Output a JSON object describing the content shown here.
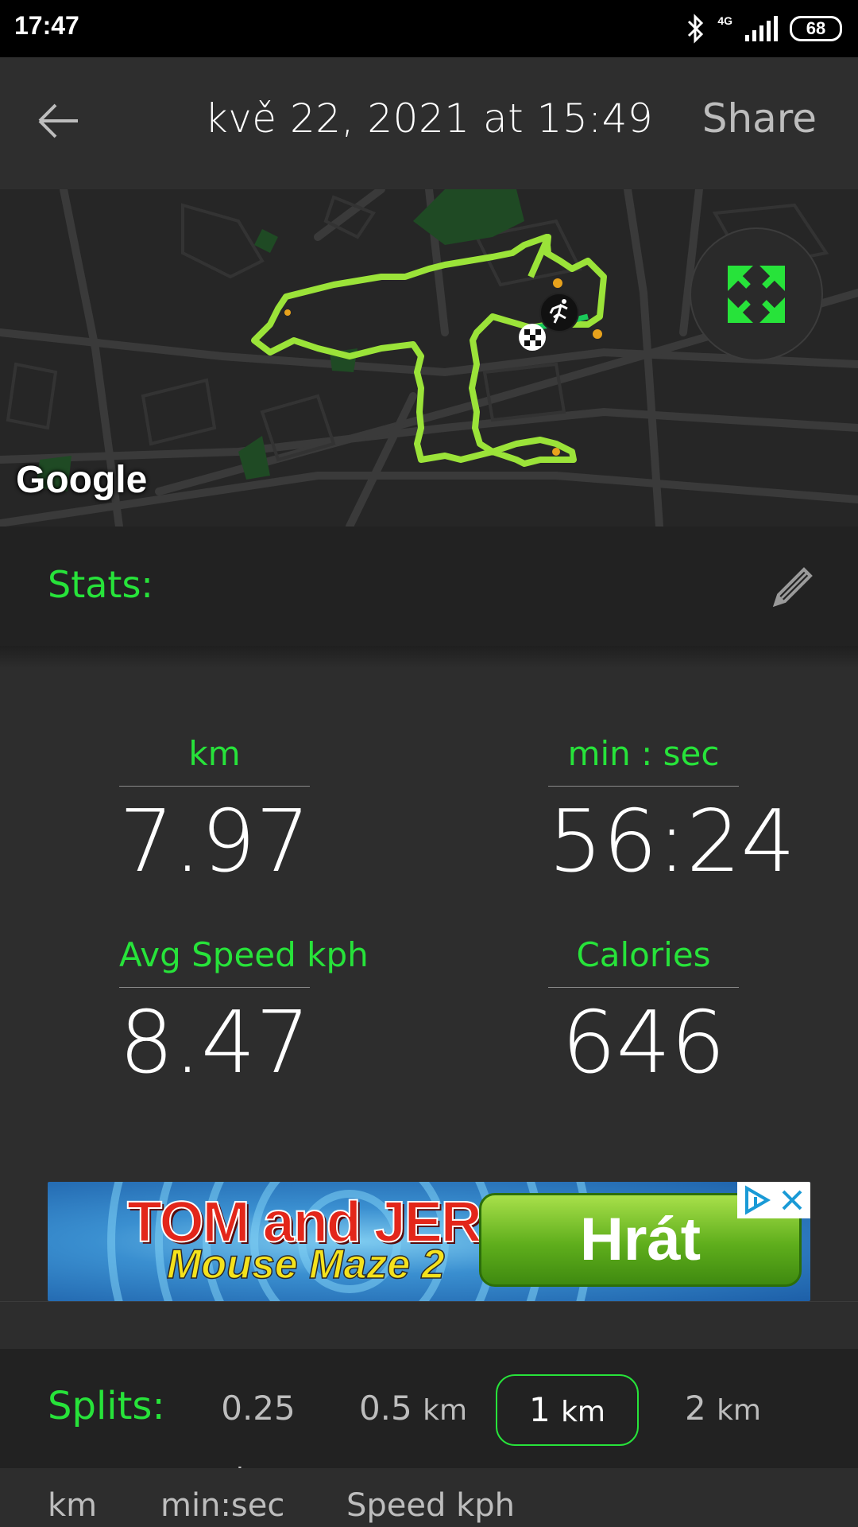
{
  "status_bar": {
    "time": "17:47",
    "network": "4G",
    "battery": "68"
  },
  "header": {
    "title": "kvě 22, 2021 at 15:49",
    "share_label": "Share"
  },
  "map": {
    "attribution": "Google"
  },
  "stats": {
    "heading": "Stats:",
    "items": [
      {
        "label": "km",
        "value": "7.97"
      },
      {
        "label": "min : sec",
        "value": "56:24"
      },
      {
        "label": "Avg Speed kph",
        "value": "8.47"
      },
      {
        "label": "Calories",
        "value": "646"
      }
    ]
  },
  "ad": {
    "title_line1": "TOM and JERRY",
    "title_line2": "Mouse Maze 2",
    "cta": "Hrát"
  },
  "splits": {
    "heading": "Splits:",
    "options": [
      {
        "value": "0.25",
        "unit": "km"
      },
      {
        "value": "0.5",
        "unit": "km"
      },
      {
        "value": "1",
        "unit": "km"
      },
      {
        "value": "2",
        "unit": "km"
      }
    ],
    "selected": "1 km"
  },
  "table": {
    "columns": [
      "km",
      "min:sec",
      "Speed kph"
    ]
  },
  "colors": {
    "accent": "#27e33a",
    "route": "#9be339",
    "background": "#2d2d2d"
  }
}
